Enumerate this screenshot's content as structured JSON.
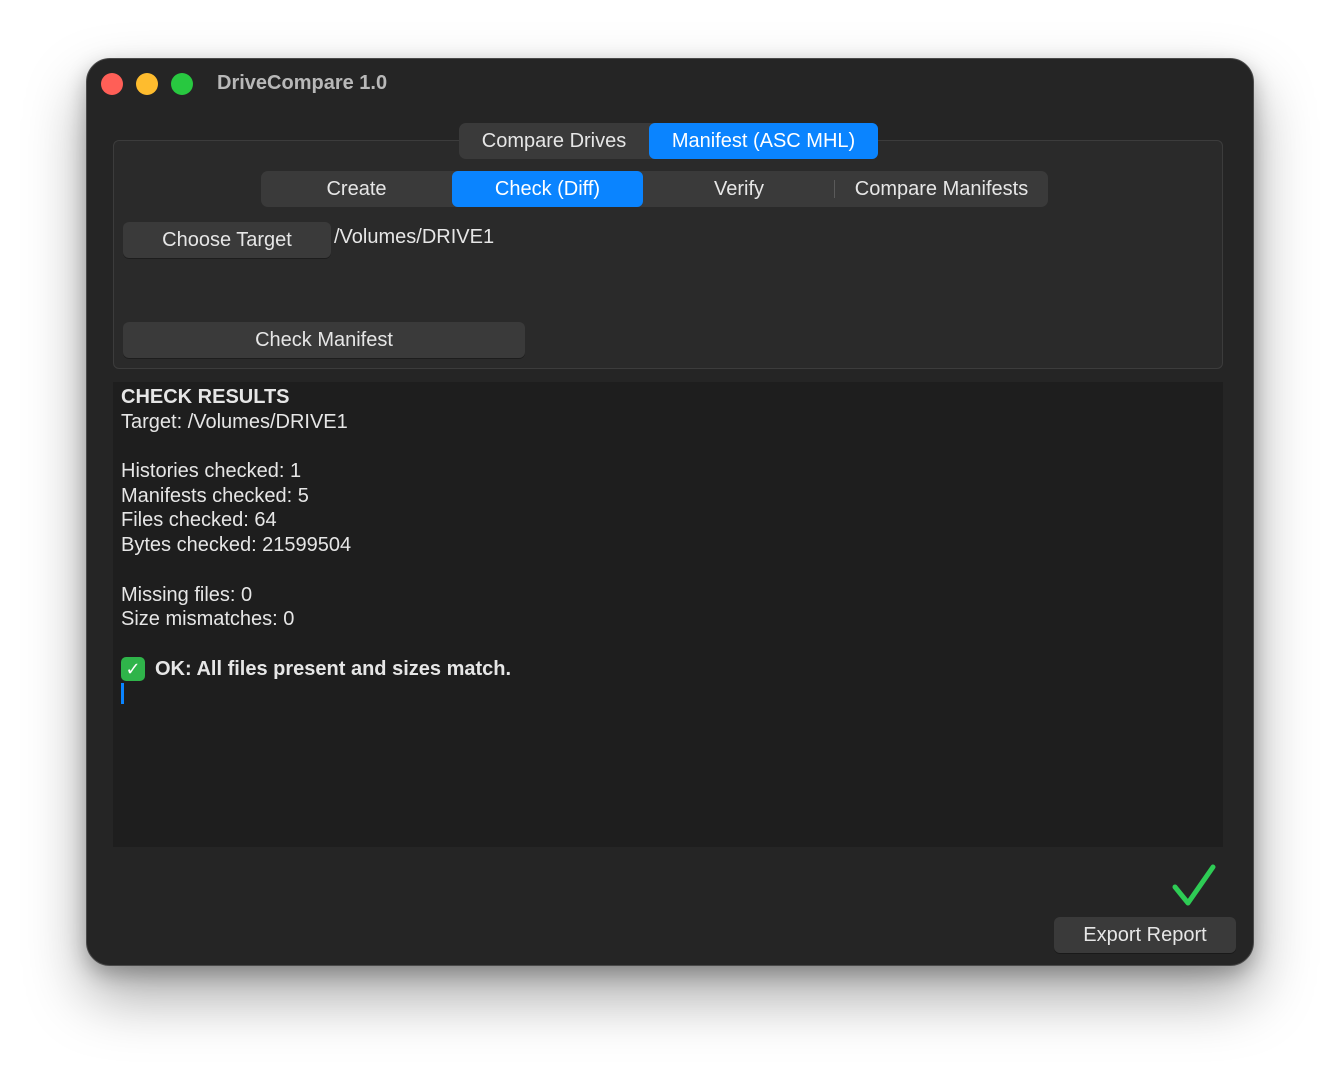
{
  "window": {
    "title": "DriveCompare 1.0"
  },
  "main_tabs": [
    {
      "label": "Compare Drives",
      "active": false
    },
    {
      "label": "Manifest (ASC MHL)",
      "active": true
    }
  ],
  "sub_tabs": [
    {
      "label": "Create",
      "active": false
    },
    {
      "label": "Check (Diff)",
      "active": true
    },
    {
      "label": "Verify",
      "active": false
    },
    {
      "label": "Compare Manifests",
      "active": false
    }
  ],
  "target": {
    "button_label": "Choose Target",
    "path": "/Volumes/DRIVE1"
  },
  "check_button_label": "Check Manifest",
  "results": {
    "heading": "CHECK RESULTS",
    "target_line": "Target: /Volumes/DRIVE1",
    "histories": "Histories checked: 1",
    "manifests": "Manifests checked: 5",
    "files": "Files checked: 64",
    "bytes": "Bytes checked: 21599504",
    "missing": "Missing files: 0",
    "size_mismatches": "Size mismatches: 0",
    "ok_message": "OK: All files present and sizes match.",
    "ok_icon": "white-heavy-check-mark-emoji"
  },
  "status_icon": "green-checkmark-icon",
  "export_button_label": "Export Report",
  "colors": {
    "accent": "#0a84ff",
    "success": "#2ecc55",
    "window_bg": "#252525",
    "results_bg": "#1e1e1e",
    "traffic_close": "#ff5f57",
    "traffic_minimize": "#febc2e",
    "traffic_maximize": "#28c840"
  }
}
